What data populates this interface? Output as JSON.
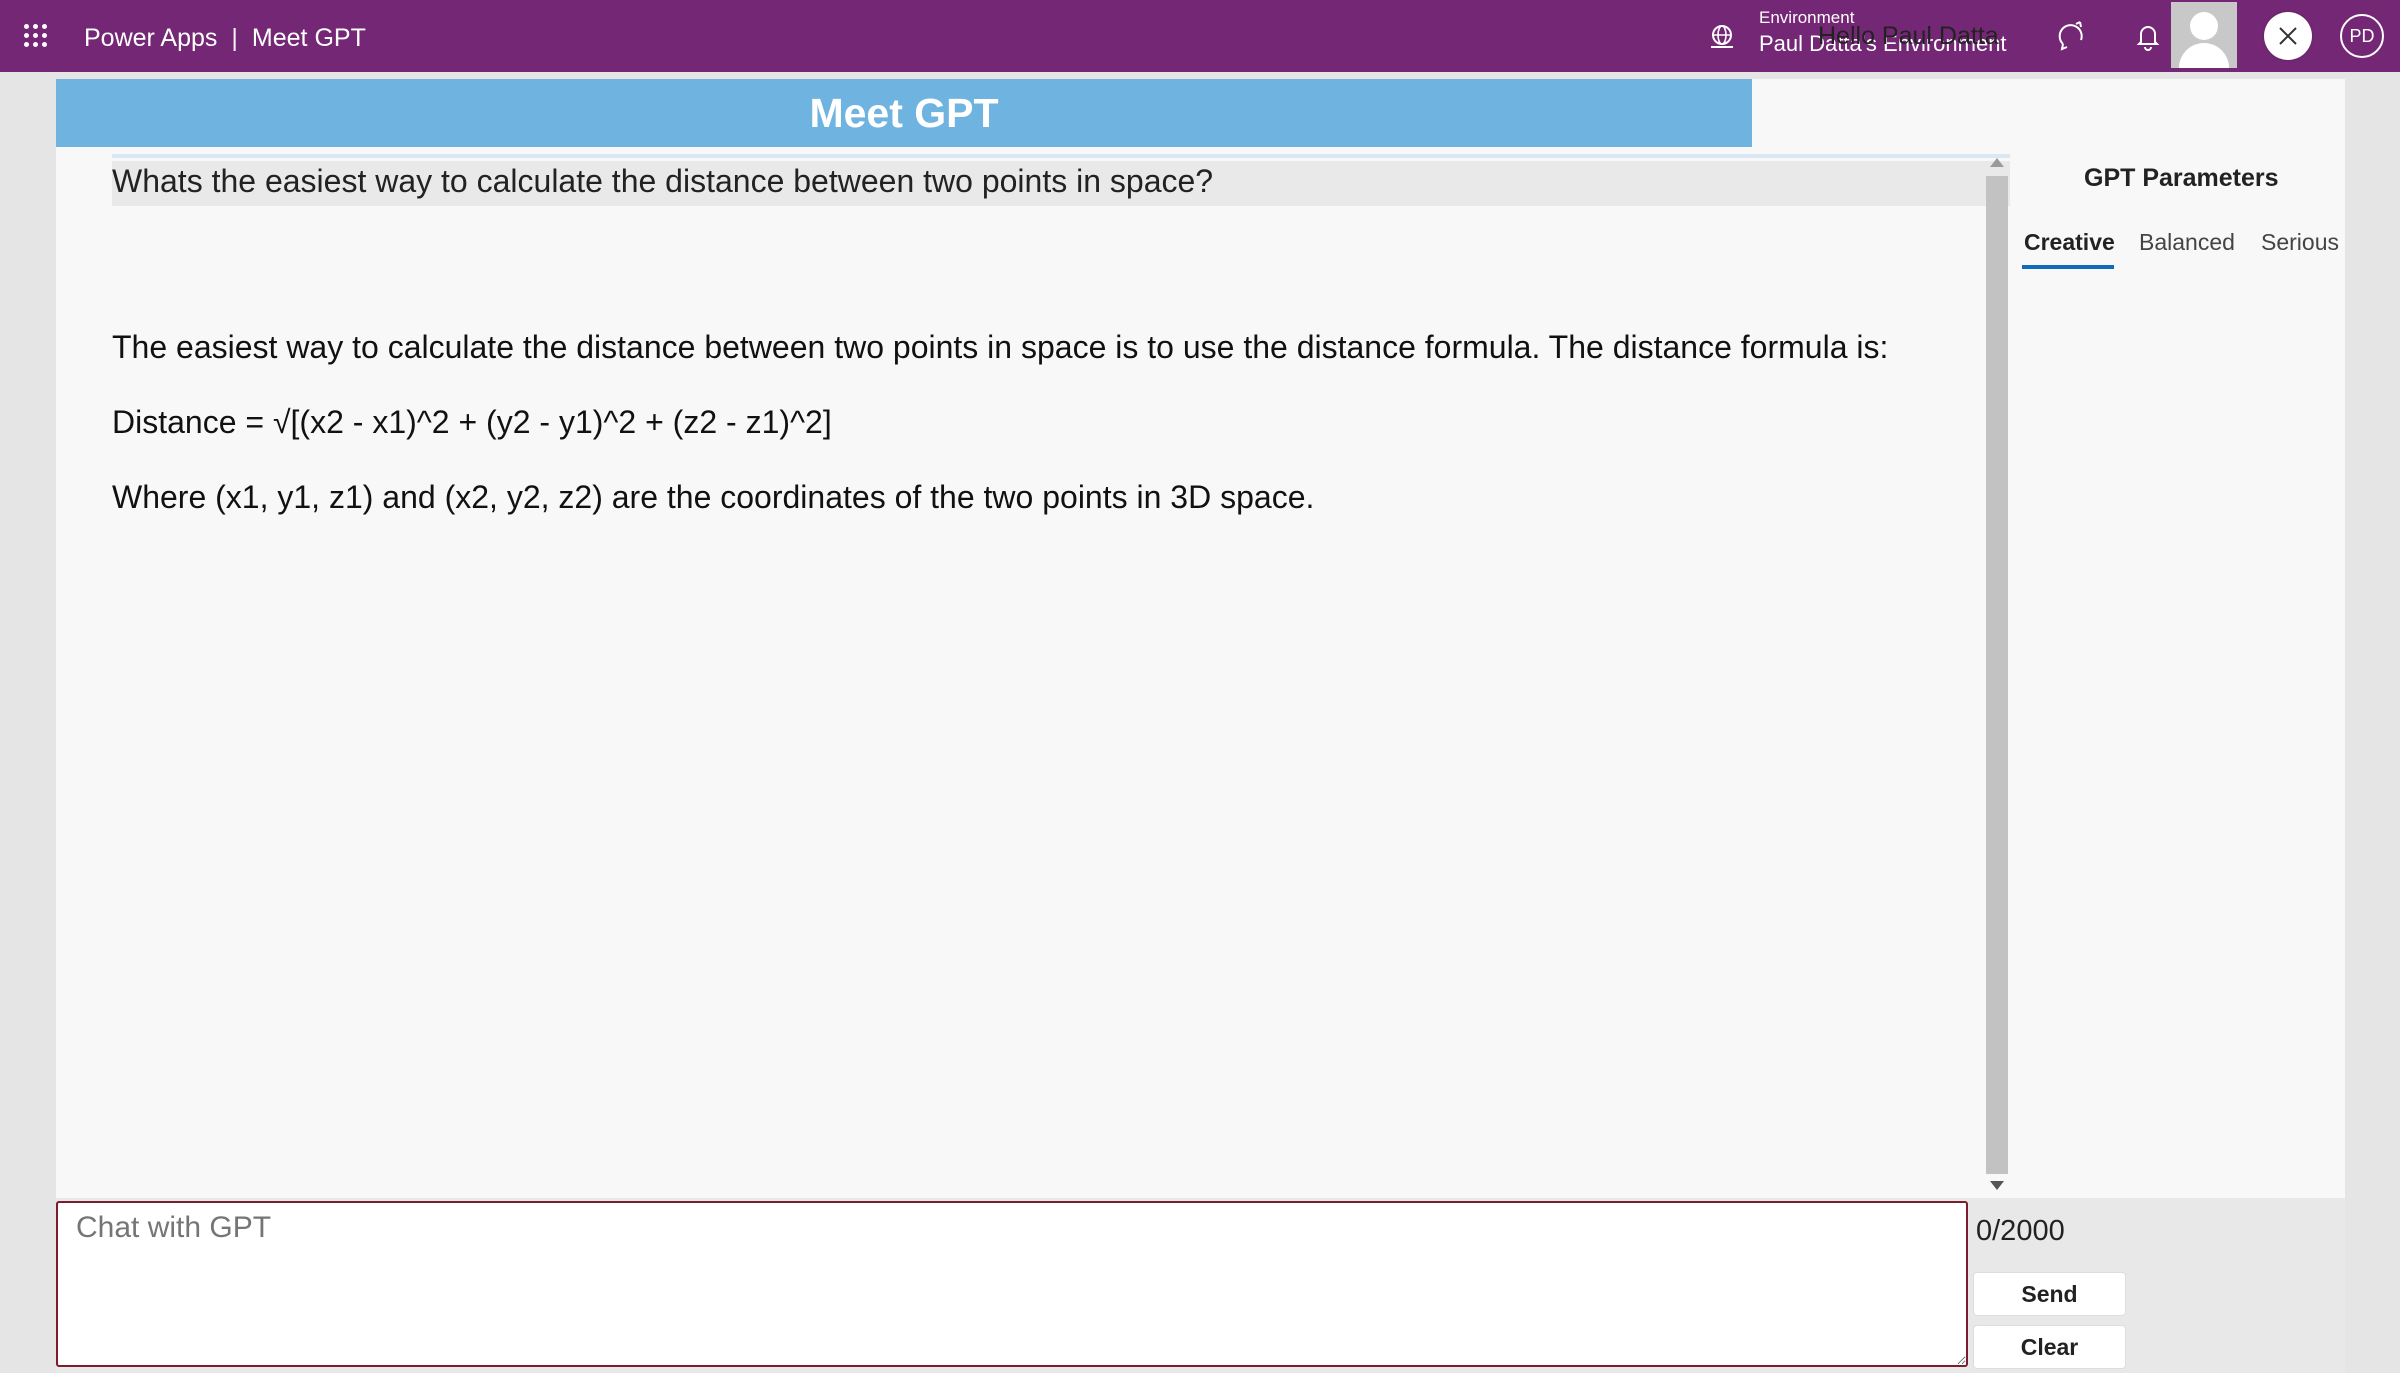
{
  "topbar": {
    "app_name": "Power Apps",
    "separator": "|",
    "app_title": "Meet GPT",
    "environment_label": "Environment",
    "environment_name": "Paul Datta's Environment",
    "avatar_initials": "PD",
    "icons": [
      "waffle-icon",
      "environment-icon",
      "copilot-icon",
      "bell-icon",
      "gear-icon",
      "help-icon"
    ]
  },
  "app": {
    "title": "Meet GPT",
    "greeting": "Hello Paul Datta",
    "close_icon": "close-icon"
  },
  "chat": {
    "question": "Whats the easiest way to calculate the distance between two points in space?",
    "answer_lines": [
      "The easiest way to calculate the distance between two points in space is to use the distance formula. The distance formula is:",
      "Distance = √[(x2 - x1)^2 + (y2 - y1)^2 + (z2 - z1)^2]",
      "Where (x1, y1, z1) and (x2, y2, z2) are the coordinates of the two points in 3D space."
    ]
  },
  "params": {
    "title": "GPT Parameters",
    "tabs": [
      "Creative",
      "Balanced",
      "Serious"
    ],
    "active_tab": "Creative"
  },
  "input": {
    "placeholder": "Chat with GPT",
    "counter": "0/2000",
    "send_label": "Send",
    "clear_label": "Clear"
  },
  "colors": {
    "topbar": "#742774",
    "titlebar": "#6fb3e0",
    "input_border": "#7b1d2c",
    "active_tab_underline": "#0f6cbd"
  }
}
